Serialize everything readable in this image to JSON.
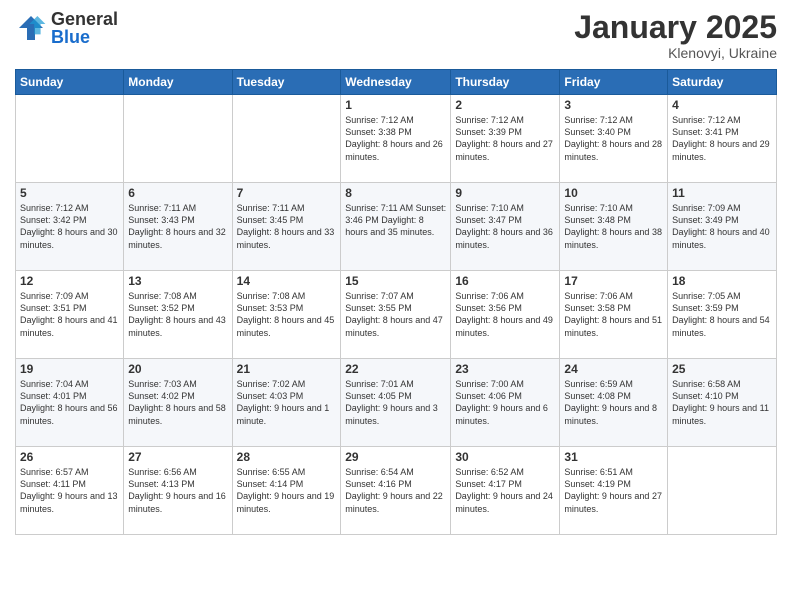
{
  "logo": {
    "general": "General",
    "blue": "Blue"
  },
  "title": "January 2025",
  "location": "Klenovyi, Ukraine",
  "days_header": [
    "Sunday",
    "Monday",
    "Tuesday",
    "Wednesday",
    "Thursday",
    "Friday",
    "Saturday"
  ],
  "weeks": [
    [
      {
        "day": "",
        "info": ""
      },
      {
        "day": "",
        "info": ""
      },
      {
        "day": "",
        "info": ""
      },
      {
        "day": "1",
        "info": "Sunrise: 7:12 AM\nSunset: 3:38 PM\nDaylight: 8 hours and 26 minutes."
      },
      {
        "day": "2",
        "info": "Sunrise: 7:12 AM\nSunset: 3:39 PM\nDaylight: 8 hours and 27 minutes."
      },
      {
        "day": "3",
        "info": "Sunrise: 7:12 AM\nSunset: 3:40 PM\nDaylight: 8 hours and 28 minutes."
      },
      {
        "day": "4",
        "info": "Sunrise: 7:12 AM\nSunset: 3:41 PM\nDaylight: 8 hours and 29 minutes."
      }
    ],
    [
      {
        "day": "5",
        "info": "Sunrise: 7:12 AM\nSunset: 3:42 PM\nDaylight: 8 hours and 30 minutes."
      },
      {
        "day": "6",
        "info": "Sunrise: 7:11 AM\nSunset: 3:43 PM\nDaylight: 8 hours and 32 minutes."
      },
      {
        "day": "7",
        "info": "Sunrise: 7:11 AM\nSunset: 3:45 PM\nDaylight: 8 hours and 33 minutes."
      },
      {
        "day": "8",
        "info": "Sunrise: 7:11 AM\nSunset: 3:46 PM\nDaylight: 8 hours and 35 minutes."
      },
      {
        "day": "9",
        "info": "Sunrise: 7:10 AM\nSunset: 3:47 PM\nDaylight: 8 hours and 36 minutes."
      },
      {
        "day": "10",
        "info": "Sunrise: 7:10 AM\nSunset: 3:48 PM\nDaylight: 8 hours and 38 minutes."
      },
      {
        "day": "11",
        "info": "Sunrise: 7:09 AM\nSunset: 3:49 PM\nDaylight: 8 hours and 40 minutes."
      }
    ],
    [
      {
        "day": "12",
        "info": "Sunrise: 7:09 AM\nSunset: 3:51 PM\nDaylight: 8 hours and 41 minutes."
      },
      {
        "day": "13",
        "info": "Sunrise: 7:08 AM\nSunset: 3:52 PM\nDaylight: 8 hours and 43 minutes."
      },
      {
        "day": "14",
        "info": "Sunrise: 7:08 AM\nSunset: 3:53 PM\nDaylight: 8 hours and 45 minutes."
      },
      {
        "day": "15",
        "info": "Sunrise: 7:07 AM\nSunset: 3:55 PM\nDaylight: 8 hours and 47 minutes."
      },
      {
        "day": "16",
        "info": "Sunrise: 7:06 AM\nSunset: 3:56 PM\nDaylight: 8 hours and 49 minutes."
      },
      {
        "day": "17",
        "info": "Sunrise: 7:06 AM\nSunset: 3:58 PM\nDaylight: 8 hours and 51 minutes."
      },
      {
        "day": "18",
        "info": "Sunrise: 7:05 AM\nSunset: 3:59 PM\nDaylight: 8 hours and 54 minutes."
      }
    ],
    [
      {
        "day": "19",
        "info": "Sunrise: 7:04 AM\nSunset: 4:01 PM\nDaylight: 8 hours and 56 minutes."
      },
      {
        "day": "20",
        "info": "Sunrise: 7:03 AM\nSunset: 4:02 PM\nDaylight: 8 hours and 58 minutes."
      },
      {
        "day": "21",
        "info": "Sunrise: 7:02 AM\nSunset: 4:03 PM\nDaylight: 9 hours and 1 minute."
      },
      {
        "day": "22",
        "info": "Sunrise: 7:01 AM\nSunset: 4:05 PM\nDaylight: 9 hours and 3 minutes."
      },
      {
        "day": "23",
        "info": "Sunrise: 7:00 AM\nSunset: 4:06 PM\nDaylight: 9 hours and 6 minutes."
      },
      {
        "day": "24",
        "info": "Sunrise: 6:59 AM\nSunset: 4:08 PM\nDaylight: 9 hours and 8 minutes."
      },
      {
        "day": "25",
        "info": "Sunrise: 6:58 AM\nSunset: 4:10 PM\nDaylight: 9 hours and 11 minutes."
      }
    ],
    [
      {
        "day": "26",
        "info": "Sunrise: 6:57 AM\nSunset: 4:11 PM\nDaylight: 9 hours and 13 minutes."
      },
      {
        "day": "27",
        "info": "Sunrise: 6:56 AM\nSunset: 4:13 PM\nDaylight: 9 hours and 16 minutes."
      },
      {
        "day": "28",
        "info": "Sunrise: 6:55 AM\nSunset: 4:14 PM\nDaylight: 9 hours and 19 minutes."
      },
      {
        "day": "29",
        "info": "Sunrise: 6:54 AM\nSunset: 4:16 PM\nDaylight: 9 hours and 22 minutes."
      },
      {
        "day": "30",
        "info": "Sunrise: 6:52 AM\nSunset: 4:17 PM\nDaylight: 9 hours and 24 minutes."
      },
      {
        "day": "31",
        "info": "Sunrise: 6:51 AM\nSunset: 4:19 PM\nDaylight: 9 hours and 27 minutes."
      },
      {
        "day": "",
        "info": ""
      }
    ]
  ]
}
